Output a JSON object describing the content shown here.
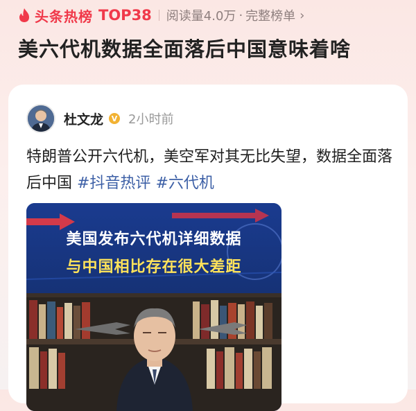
{
  "header": {
    "brand": "头条热榜",
    "rank": "TOP38",
    "reads": "阅读量4.0万",
    "separator_dot": "·",
    "full_list": "完整榜单",
    "chevron": "›"
  },
  "headline": "美六代机数据全面落后中国意味着啥",
  "post": {
    "author": "杜文龙",
    "verified_badge": "V",
    "time": "2小时前",
    "text": "特朗普公开六代机，美空军对其无比失望，数据全面落后中国 ",
    "hashtags": [
      "#抖音热评",
      "#六代机"
    ]
  },
  "video": {
    "caption_line1": "美国发布六代机详细数据",
    "caption_line2": "与中国相比存在很大差距"
  },
  "colors": {
    "accent": "#f0394a",
    "hashtag": "#3c5fa6",
    "video_banner": "#1d3d8c",
    "caption_yellow": "#ffe35a"
  }
}
